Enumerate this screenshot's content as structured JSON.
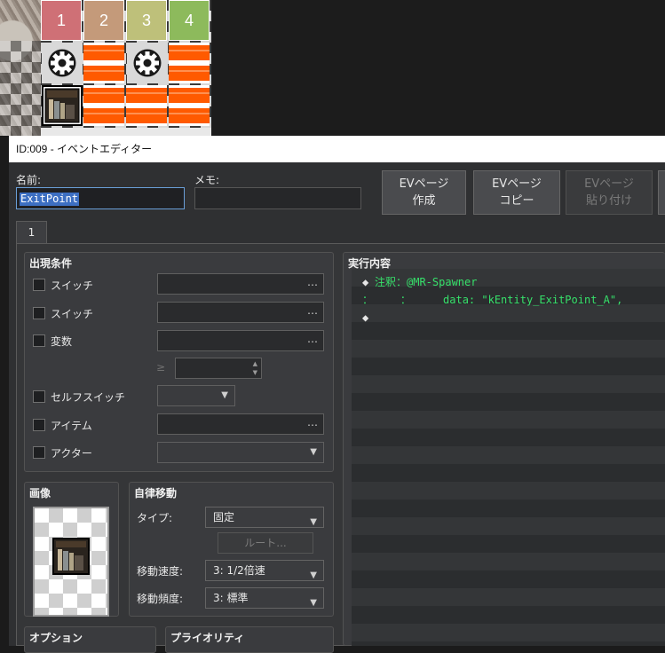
{
  "map": {
    "region_tiles": [
      {
        "label": "1",
        "color": "#cf7076"
      },
      {
        "label": "2",
        "color": "#c49a7a"
      },
      {
        "label": "3",
        "color": "#bec07a"
      },
      {
        "label": "4",
        "color": "#8dba5c"
      }
    ]
  },
  "window": {
    "title": "ID:009 - イベントエディター"
  },
  "header": {
    "name_label": "名前:",
    "name_value": "ExitPoint",
    "memo_label": "メモ:",
    "memo_value": "",
    "buttons": [
      {
        "line1": "EVページ",
        "line2": "作成",
        "enabled": true
      },
      {
        "line1": "EVページ",
        "line2": "コピー",
        "enabled": true
      },
      {
        "line1": "EVページ",
        "line2": "貼り付け",
        "enabled": false
      }
    ]
  },
  "tabs": [
    {
      "label": "1"
    }
  ],
  "conditions": {
    "title": "出現条件",
    "items": [
      {
        "label": "スイッチ",
        "type": "dots"
      },
      {
        "label": "スイッチ",
        "type": "dots"
      },
      {
        "label": "変数",
        "type": "dots"
      },
      {
        "label": "セルフスイッチ",
        "type": "combo"
      },
      {
        "label": "アイテム",
        "type": "dots"
      },
      {
        "label": "アクター",
        "type": "combo"
      }
    ],
    "compare_symbol": "≥",
    "ellipsis": "…"
  },
  "image": {
    "title": "画像"
  },
  "autonomous": {
    "title": "自律移動",
    "type_label": "タイプ:",
    "type_value": "固定",
    "route_button": "ルート...",
    "speed_label": "移動速度:",
    "speed_value": "3: 1/2倍速",
    "freq_label": "移動頻度:",
    "freq_value": "3: 標準"
  },
  "options": {
    "title": "オプション"
  },
  "priority": {
    "title": "プライオリティ"
  },
  "contents": {
    "title": "実行内容",
    "lines": [
      {
        "prefix": "◆",
        "text": "注釈：@MR-Spawner",
        "color": "#36e06a"
      },
      {
        "prefix": "：",
        "text": "    ：     data: \"kEntity_ExitPoint_A\",",
        "color": "#36e06a"
      },
      {
        "prefix": "◆",
        "text": "",
        "color": "#e6e6e6"
      }
    ]
  },
  "colors": {
    "accent": "#3d6fc2",
    "comment": "#36e06a",
    "stripe": "#ff5a00"
  }
}
